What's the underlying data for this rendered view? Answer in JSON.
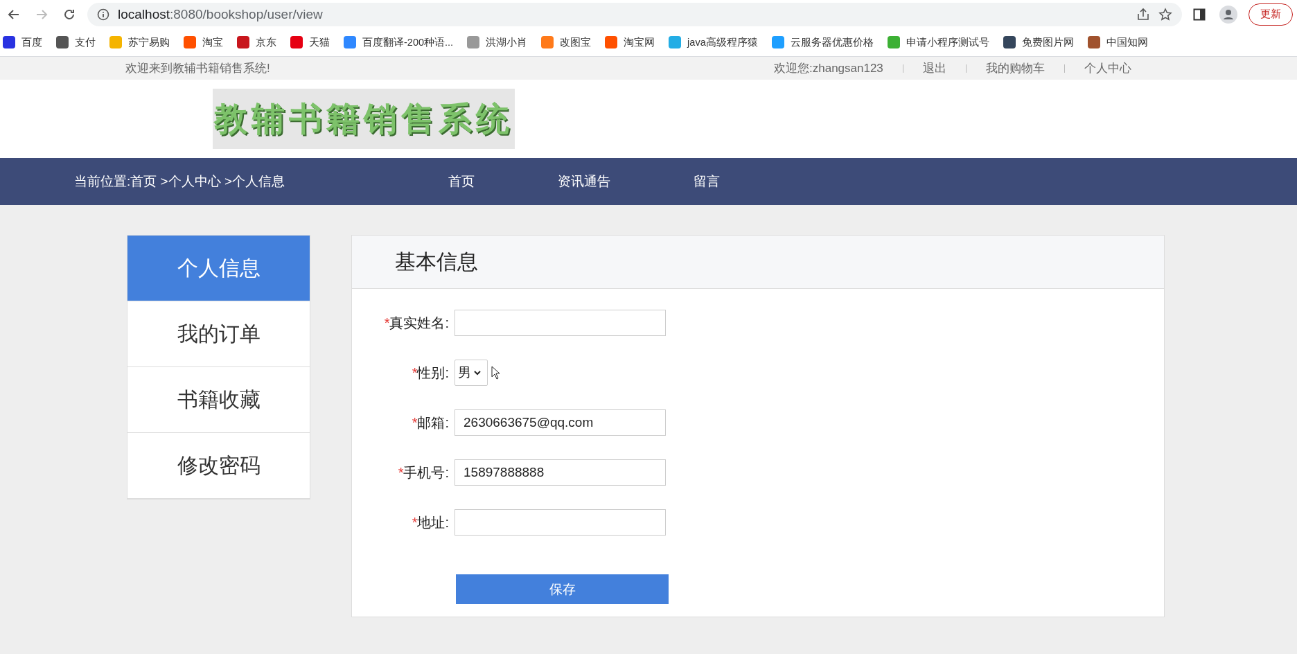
{
  "browser": {
    "url_host": "localhost",
    "url_path": ":8080/bookshop/user/view",
    "update_button": "更新"
  },
  "bookmarks": [
    {
      "label": "百度",
      "color": "#2932e1"
    },
    {
      "label": "支付",
      "color": "#555555"
    },
    {
      "label": "苏宁易购",
      "color": "#f5b400"
    },
    {
      "label": "淘宝",
      "color": "#ff5000"
    },
    {
      "label": "京东",
      "color": "#c8161d"
    },
    {
      "label": "天猫",
      "color": "#e60012"
    },
    {
      "label": "百度翻译-200种语...",
      "color": "#2f88ff"
    },
    {
      "label": "洪湖小肖",
      "color": "#999999"
    },
    {
      "label": "改图宝",
      "color": "#ff7a1a"
    },
    {
      "label": "淘宝网",
      "color": "#ff5000"
    },
    {
      "label": "java高级程序猿",
      "color": "#23ade5"
    },
    {
      "label": "云服务器优惠价格",
      "color": "#1e9fff"
    },
    {
      "label": "申请小程序测试号",
      "color": "#3cb034"
    },
    {
      "label": "免费图片网",
      "color": "#35465c"
    },
    {
      "label": "中国知网",
      "color": "#a0522d"
    }
  ],
  "topbar": {
    "welcome": "欢迎来到教辅书籍销售系统!",
    "user": "欢迎您:zhangsan123",
    "links": [
      "退出",
      "我的购物车",
      "个人中心"
    ]
  },
  "logo": "教辅书籍销售系统",
  "navbar": {
    "breadcrumb": "当前位置:首页 >个人中心 >个人信息",
    "links": [
      "首页",
      "资讯通告",
      "留言"
    ]
  },
  "sidebar": [
    {
      "label": "个人信息",
      "selected": true
    },
    {
      "label": "我的订单",
      "selected": false
    },
    {
      "label": "书籍收藏",
      "selected": false
    },
    {
      "label": "修改密码",
      "selected": false
    }
  ],
  "panel": {
    "title": "基本信息",
    "button": "保存"
  },
  "fields": [
    {
      "kind": "input",
      "required_mark": "*",
      "label": "真实姓名:"
    },
    {
      "kind": "select",
      "required_mark": "*",
      "label": "性别:",
      "value": "男"
    },
    {
      "kind": "input",
      "required_mark": "*",
      "label": "邮箱:",
      "value": "2630663675@qq.com"
    },
    {
      "kind": "input",
      "required_mark": "*",
      "label": "手机号:",
      "value": "15897888888"
    },
    {
      "kind": "input",
      "required_mark": "*",
      "label": "地址:"
    }
  ]
}
